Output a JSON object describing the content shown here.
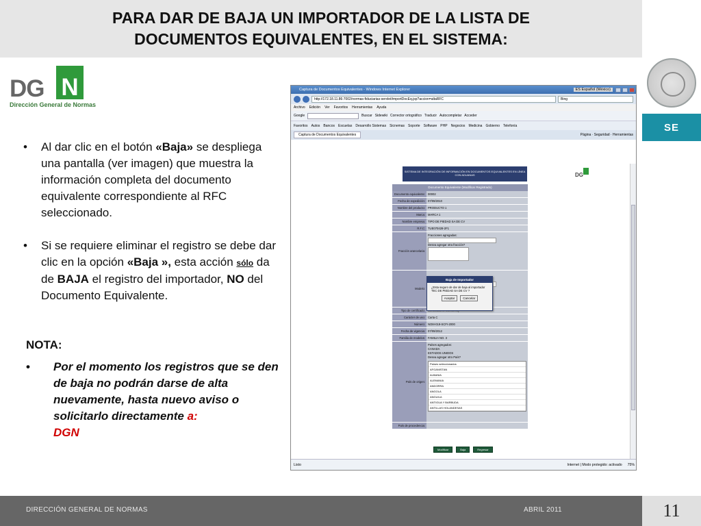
{
  "title": {
    "line1": "PARA DAR DE BAJA UN IMPORTADOR DE LA LISTA DE",
    "line2": "DOCUMENTOS EQUIVALENTES, EN EL SISTEMA:"
  },
  "logo": {
    "letters": "DG",
    "green_letter": "N",
    "subtitle": "Dirección General de Normas"
  },
  "se_label": "SE",
  "bullets": [
    {
      "dot": "•",
      "pre": "Al dar clic en el botón ",
      "bold": "«Baja»",
      "post": " se despliega una pantalla (ver imagen) que muestra la información completa del documento equivalente correspondiente al RFC seleccionado."
    },
    {
      "dot": "•",
      "pre": "Si se requiere eliminar el registro se debe dar clic en la opción ",
      "bold": "«Baja »,",
      "mid": " esta acción ",
      "underline": "sólo",
      "mid2": " da de ",
      "bold2": "BAJA",
      "mid3": " el registro del importador, ",
      "bold3": "NO",
      "post": " del Documento Equivalente."
    }
  ],
  "nota": {
    "label": "NOTA:",
    "dot": "•",
    "text": "Por el momento los registros que se den de baja no podrán darse de alta nuevamente, hasta nuevo aviso o solicitarlo directamente ",
    "red_a": "a:",
    "red_dgn": "DGN"
  },
  "browser": {
    "window_title": "Captura de Documentos Equivalentes - Windows Internet Explorer",
    "lang": "ES Español (México)",
    "address": "http://172.18.11.86:7002/normas-fiduciarias-servlet/importDocEq.jsp?accion=altaRFC",
    "search_placeholder": "Bing",
    "menu": [
      "Archivo",
      "Edición",
      "Ver",
      "Favoritos",
      "Herramientas",
      "Ayuda"
    ],
    "toolbar": [
      "Google",
      "Buscar",
      "Sidewiki",
      "Corrector ortográfico",
      "Traducir",
      "Autocompletar",
      "Acceder"
    ],
    "favorites": [
      "Favoritos",
      "Autos",
      "Bancos",
      "Escuelas",
      "Desarrollo Sistemas",
      "Sicnemas",
      "Soporte",
      "Software",
      "PHP",
      "Negocios",
      "Medicina",
      "Gobierno",
      "Telefonía"
    ],
    "tab": "Captura de Documentos Equivalentes",
    "tab_tools": "Página · Seguridad · Herramientas",
    "form_header": "SISTEMA DE INTEGRACIÓN DE INFORMACIÓN EN DOCUMENTOS EQUIVALENTES EN LÍNEA CON ADUANAS",
    "form_subheader": "Documento Equivalente (Modificar Registrado)",
    "fields": [
      {
        "label": "Documento equivalente:",
        "value": "00002"
      },
      {
        "label": "Fecha de expedición:",
        "value": "07/09/2010"
      },
      {
        "label": "Nombre del producto:",
        "value": "PRODUCTO 1"
      },
      {
        "label": "Marca:",
        "value": "MARCA 1"
      },
      {
        "label": "Nombre empresa:",
        "value": "TIPO DE PIEDAD SA DE CV"
      },
      {
        "label": "R.F.C:",
        "value": "TUE070428-2F1"
      }
    ],
    "fraccion_label": "Fracción arancelaria:",
    "fraccion_items": [
      "Fracciones agregadas:",
      "Desea agregar otra fracción?"
    ],
    "modelo_label": "Modelo:",
    "dialog": {
      "title": "Baja de Importador",
      "message": "¿Esta seguro de dar de baja al importador TEC DE PIEDAD SA DE CV ?",
      "accept": "Aceptar",
      "cancel": "Cancelar"
    },
    "lower_fields": [
      {
        "label": "Tipo de certificado:",
        "value": "Certificado of Conformity"
      },
      {
        "label": "Carácter de uso:",
        "value": "Carta C"
      },
      {
        "label": "Número:",
        "value": "NOM-019-SCFI-2000"
      },
      {
        "label": "Fecha de vigencia:",
        "value": "07/09/2012"
      },
      {
        "label": "Familia de modelos:",
        "value": "FAMILIA NO. 3"
      }
    ],
    "pais_label": "País de origen:",
    "paises_agregados": [
      "Países agregados:",
      "CANADA",
      "ESTADOS UNIDOS"
    ],
    "paises_header": "Desea agregar otro País?",
    "paises_list_title": "Países seleccionados",
    "paises_list": [
      "AFGANISTAN",
      "ALBANIA",
      "ALEMANIA",
      "ANDORRA",
      "ANGOLA",
      "ANGUILA",
      "ANTIGUA Y BARBUDA",
      "ANTILLAS HOLANDESAS"
    ],
    "procedencia_label": "País de procedencia:",
    "buttons": [
      "Modificar",
      "Baja",
      "Regresar"
    ],
    "status_left": "Listo",
    "status_zone": "Internet | Modo protegido: activado",
    "zoom": "75%"
  },
  "footer": {
    "left": "DIRECCIÓN GENERAL DE NORMAS",
    "right": "ABRIL 2011"
  },
  "page_number": "11",
  "colors": {
    "title_bg": "#e6e6e6",
    "se_box": "#1b90a5",
    "logo_green": "#2f9a3b",
    "footer_bg": "#666666",
    "red": "#d00000",
    "form_header": "#2c3e6f"
  }
}
